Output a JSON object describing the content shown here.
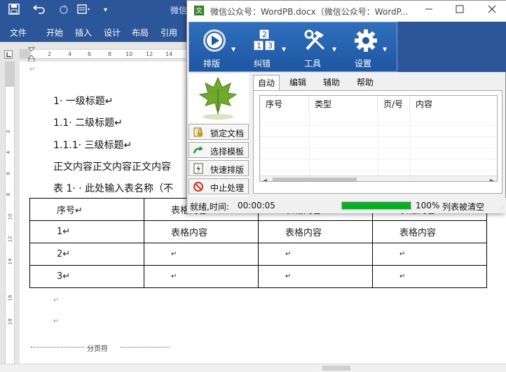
{
  "word": {
    "title": "微信",
    "tabs": [
      "文件",
      "开始",
      "插入",
      "设计",
      "布局",
      "引用"
    ],
    "ruler_top": [
      "2",
      "4",
      "6",
      "8",
      "10",
      "12",
      "14"
    ],
    "ruler_left": [
      "2",
      "4",
      "6",
      "8",
      "10",
      "12",
      "14",
      "16",
      "18"
    ],
    "paragraph_mark": "↵",
    "headings": {
      "h1": "1· 一级标题↵",
      "h2": "1.1· 二级标题↵",
      "h3": "1.1.1· 三级标题↵",
      "body": "正文内容正文内容正文内容",
      "caption": "表 1· · 此处输入表名称（不"
    },
    "table": {
      "header": [
        "序号↵",
        "表格内容",
        "表格内容",
        "表格内容"
      ],
      "rows": [
        [
          "1↵",
          "表格内容",
          "表格内容",
          "表格内容"
        ],
        [
          "2↵",
          "↵",
          "↵",
          "↵"
        ],
        [
          "3↵",
          "↵",
          "↵",
          "↵"
        ]
      ]
    },
    "page_break": "分页符"
  },
  "pb": {
    "title": "微信公众号：WordPB.docx（微信公众号：WordP...",
    "app_icon": "文",
    "toolbar": {
      "layout": "排版",
      "correct": "纠错",
      "tools": "工具",
      "settings": "设置"
    },
    "side_buttons": {
      "lock": "锁定文档",
      "template": "选择模板",
      "quick": "快速排版",
      "stop": "中止处理"
    },
    "tabs": [
      "自动",
      "编辑",
      "辅助",
      "帮助"
    ],
    "columns": [
      "序号",
      "类型",
      "页/号",
      "内容"
    ],
    "status": {
      "ready": "就绪,时间:",
      "time": "00:00:05",
      "progress_text": "100%",
      "message": "列表被清空",
      "progress": 1.0
    }
  },
  "colors": {
    "word_blue": "#2b579a",
    "progress_green": "#06b025"
  }
}
